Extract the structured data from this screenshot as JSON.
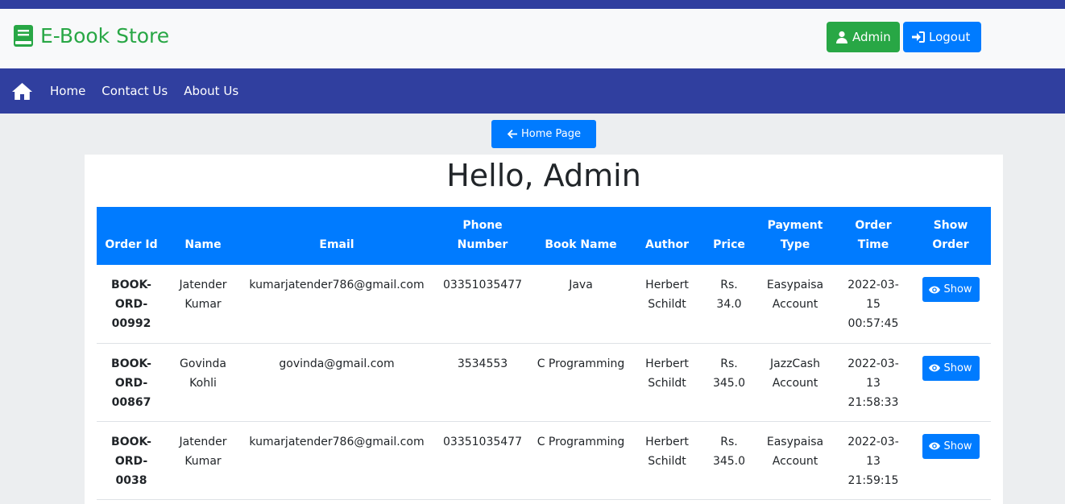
{
  "header": {
    "brand": "E-Book Store",
    "admin_label": "Admin",
    "logout_label": "Logout"
  },
  "nav": {
    "items": [
      "Home",
      "Contact Us",
      "About Us"
    ]
  },
  "home_page_button": "Home Page",
  "page_title": "Hello, Admin",
  "table": {
    "columns": [
      "Order Id",
      "Name",
      "Email",
      "Phone Number",
      "Book Name",
      "Author",
      "Price",
      "Payment Type",
      "Order Time",
      "Show Order"
    ],
    "rows": [
      [
        "BOOK-ORD-00992",
        "Jatender Kumar",
        "kumarjatender786@gmail.com",
        "03351035477",
        "Java",
        "Herbert Schildt",
        "Rs. 34.0",
        "Easypaisa Account",
        "2022-03-15 00:57:45",
        "Show"
      ],
      [
        "BOOK-ORD-00867",
        "Govinda Kohli",
        "govinda@gmail.com",
        "3534553",
        "C Programming",
        "Herbert Schildt",
        "Rs. 345.0",
        "JazzCash Account",
        "2022-03-13 21:58:33",
        "Show"
      ],
      [
        "BOOK-ORD-0038",
        "Jatender Kumar",
        "kumarjatender786@gmail.com",
        "03351035477",
        "C Programming",
        "Herbert Schildt",
        "Rs. 345.0",
        "Easypaisa Account",
        "2022-03-13 21:59:15",
        "Show"
      ]
    ]
  },
  "colors": {
    "navbar": "#303f9f",
    "brand": "#28a745",
    "primary": "#007bff",
    "admin_button": "#28a745"
  },
  "icons": {
    "brand": "book-icon",
    "admin": "user-icon",
    "logout": "sign-in-icon",
    "nav_home": "home-icon",
    "back": "arrow-left-icon",
    "show": "eye-icon"
  }
}
